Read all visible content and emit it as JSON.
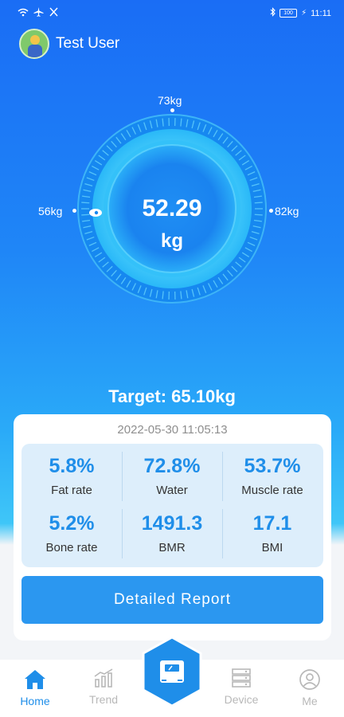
{
  "status_bar": {
    "time": "11:11",
    "battery": "100"
  },
  "user": {
    "name": "Test User"
  },
  "gauge": {
    "value": "52.29",
    "unit": "kg",
    "scale_top": "73kg",
    "scale_left": "56kg",
    "scale_right": "82kg"
  },
  "target": "Target: 65.10kg",
  "card": {
    "timestamp": "2022-05-30 11:05:13",
    "metrics": [
      {
        "value": "5.8%",
        "label": "Fat rate"
      },
      {
        "value": "72.8%",
        "label": "Water"
      },
      {
        "value": "53.7%",
        "label": "Muscle rate"
      },
      {
        "value": "5.2%",
        "label": "Bone rate"
      },
      {
        "value": "1491.3",
        "label": "BMR"
      },
      {
        "value": "17.1",
        "label": "BMI"
      }
    ],
    "report_button": "Detailed Report"
  },
  "nav": {
    "items": [
      {
        "label": "Home",
        "icon": "home-icon",
        "active": true
      },
      {
        "label": "Trend",
        "icon": "trend-icon",
        "active": false
      },
      {
        "label": "Device",
        "icon": "device-icon",
        "active": false
      },
      {
        "label": "Me",
        "icon": "profile-icon",
        "active": false
      }
    ],
    "center_icon": "scale-icon"
  },
  "colors": {
    "accent": "#2b97f0",
    "metric_text": "#1f8ee9",
    "metric_bg": "#ddeefb"
  }
}
